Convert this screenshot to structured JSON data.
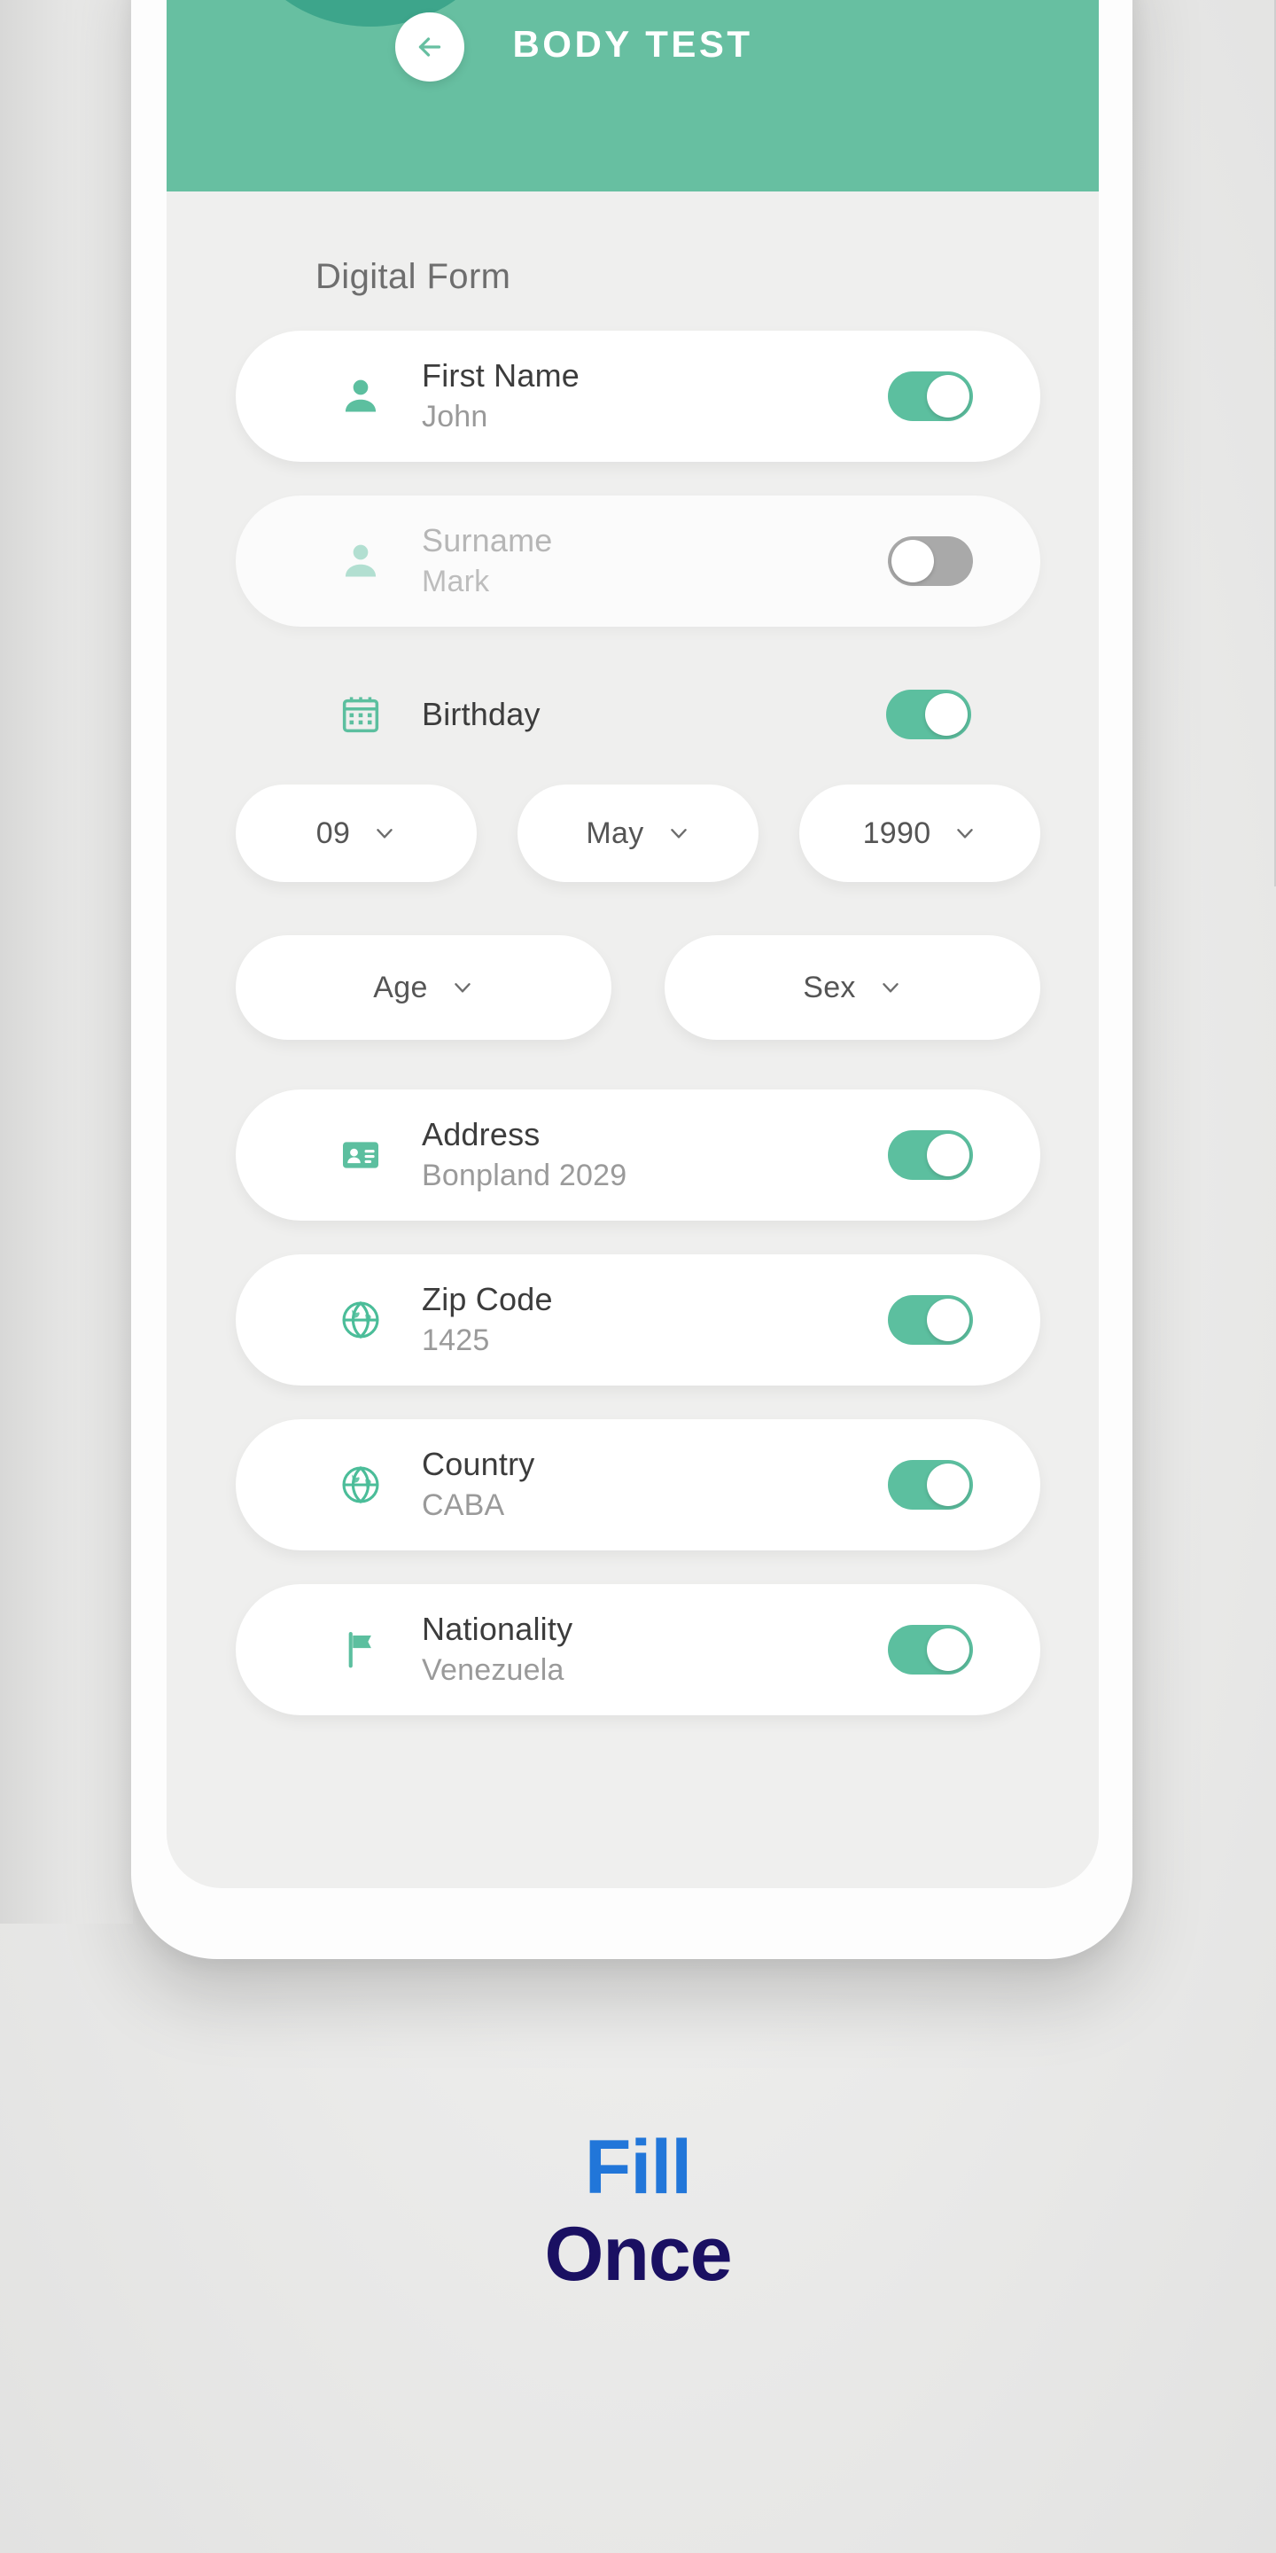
{
  "header": {
    "title": "BODY TEST",
    "back_icon": "arrow-left-icon",
    "background_color": "#67bfa1"
  },
  "section": {
    "title": "Digital Form"
  },
  "fields": [
    {
      "icon": "person-icon",
      "label": "First Name",
      "value": "John",
      "toggle": "on",
      "dim": false
    },
    {
      "icon": "person-icon",
      "label": "Surname",
      "value": "Mark",
      "toggle": "off",
      "dim": true
    }
  ],
  "birthday": {
    "icon": "calendar-icon",
    "label": "Birthday",
    "toggle": "on",
    "day": "09",
    "month": "May",
    "year": "1990",
    "chevron_icon": "chevron-down-icon"
  },
  "demographics": {
    "age": "Age",
    "sex": "Sex",
    "chevron_icon": "chevron-down-icon"
  },
  "address_fields": [
    {
      "icon": "id-card-icon",
      "label": "Address",
      "value": "Bonpland 2029",
      "toggle": "on"
    },
    {
      "icon": "globe-icon",
      "label": "Zip Code",
      "value": "1425",
      "toggle": "on"
    },
    {
      "icon": "globe-icon",
      "label": "Country",
      "value": "CABA",
      "toggle": "on"
    },
    {
      "icon": "flag-icon",
      "label": "Nationality",
      "value": "Venezuela",
      "toggle": "on"
    }
  ],
  "caption": {
    "line1": "Fill",
    "line2": "Once",
    "line1_color": "#2176d9",
    "line2_color": "#1a1062"
  },
  "colors": {
    "accent_green": "#5cbf9f",
    "header_green": "#67bfa1",
    "deco_green": "#3da58b",
    "toggle_off": "#a9a9a9",
    "screen_bg": "#efefee"
  }
}
